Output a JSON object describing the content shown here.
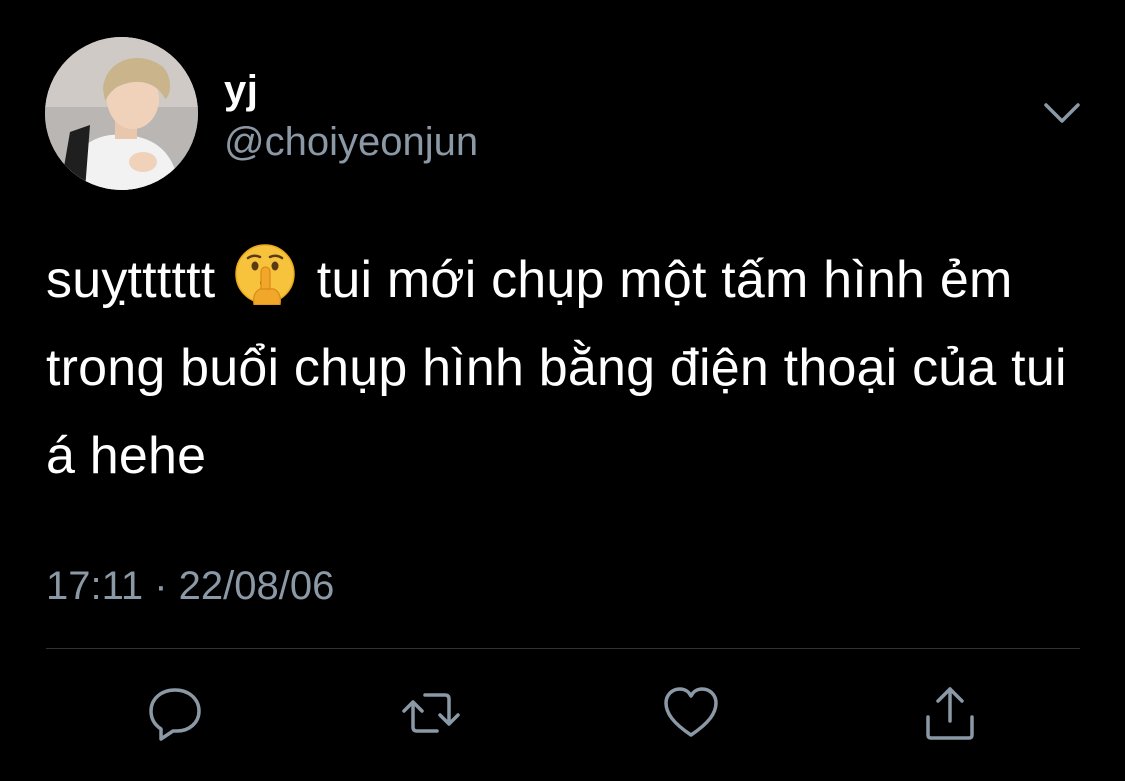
{
  "user": {
    "display_name": "yj",
    "handle": "@choiyeonjun",
    "avatar_icon": "profile-photo"
  },
  "tweet": {
    "text_before_emoji": "suỵtttttt",
    "emoji_icon": "shushing-face-emoji",
    "text_after_emoji": "tui mới chụp một tấm hình ẻm trong buổi chụp hình bằng điện thoại của tui á hehe",
    "timestamp": "17:11 · 22/08/06"
  },
  "actions": {
    "reply_icon": "reply-icon",
    "retweet_icon": "retweet-icon",
    "like_icon": "heart-icon",
    "share_icon": "share-icon"
  },
  "theme": {
    "background": "#000000",
    "text": "#ffffff",
    "secondary_text": "#8b98a5",
    "divider": "#2f3336"
  }
}
